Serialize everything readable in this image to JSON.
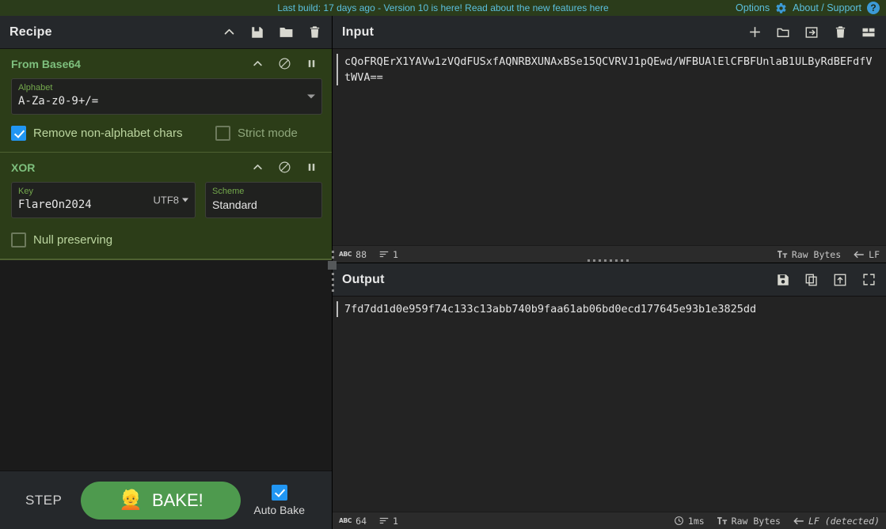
{
  "banner": {
    "message": "Last build: 17 days ago - Version 10 is here! Read about the new features here",
    "options_label": "Options",
    "about_label": "About / Support",
    "gear_icon": "gear-icon",
    "help_icon": "question-mark-icon",
    "link_color": "#5bc0de",
    "background": "#2b3c1b"
  },
  "recipe": {
    "title": "Recipe",
    "icons": [
      "chevron-up-icon",
      "save-icon",
      "folder-icon",
      "trash-icon"
    ],
    "operations": [
      {
        "name": "From Base64",
        "icons": [
          "chevron-up-icon",
          "disable-icon",
          "pause-icon"
        ],
        "args": [
          {
            "type": "select",
            "label": "Alphabet",
            "value": "A-Za-z0-9+/="
          }
        ],
        "checkboxes": [
          {
            "label": "Remove non-alphabet chars",
            "checked": true
          },
          {
            "label": "Strict mode",
            "checked": false
          }
        ]
      },
      {
        "name": "XOR",
        "icons": [
          "chevron-up-icon",
          "disable-icon",
          "pause-icon"
        ],
        "args": [
          {
            "type": "toggle-string",
            "label": "Key",
            "value": "FlareOn2024",
            "encoding": "UTF8"
          },
          {
            "type": "select",
            "label": "Scheme",
            "value": "Standard"
          }
        ],
        "checkboxes": [
          {
            "label": "Null preserving",
            "checked": false
          }
        ]
      }
    ]
  },
  "controls": {
    "step_label": "STEP",
    "bake_label": "BAKE!",
    "bake_icon": "chef-icon",
    "bake_color": "#4e9a4e",
    "auto_bake_label": "Auto Bake",
    "auto_bake_checked": true
  },
  "input": {
    "title": "Input",
    "icons": [
      "add-tab-icon",
      "open-folder-icon",
      "open-file-icon",
      "clear-icon",
      "tab-layout-icon"
    ],
    "value": "cQoFRQErX1YAVw1zVQdFUSxfAQNRBXUNAxBSe15QCVRVJ1pQEwd/WFBUAlElCFBFUnlaB1ULByRdBEFdfVtWVA==",
    "status": {
      "length_icon": "abc-icon",
      "length": "88",
      "lines_icon": "lines-icon",
      "lines": "1",
      "encoding_icon": "font-icon",
      "encoding": "Raw Bytes",
      "line_ending_icon": "return-icon",
      "line_ending": "LF"
    }
  },
  "output": {
    "title": "Output",
    "icons": [
      "save-icon",
      "copy-icon",
      "replace-input-icon",
      "maximise-icon"
    ],
    "value": "7fd7dd1d0e959f74c133c13abb740b9faa61ab06bd0ecd177645e93b1e3825dd",
    "status": {
      "length_icon": "abc-icon",
      "length": "64",
      "lines_icon": "lines-icon",
      "lines": "1",
      "time_icon": "clock-icon",
      "bake_time": "1ms",
      "encoding_icon": "font-icon",
      "encoding": "Raw Bytes",
      "line_ending_icon": "return-icon",
      "line_ending": "LF (detected)"
    }
  }
}
